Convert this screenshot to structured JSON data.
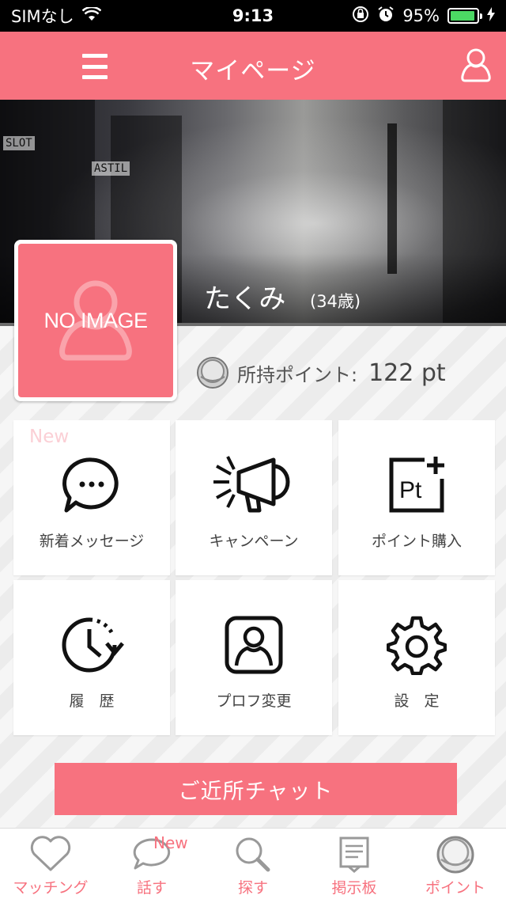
{
  "status_bar": {
    "carrier": "SIMなし",
    "time": "9:13",
    "battery": "95%",
    "battery_level": 0.95
  },
  "nav": {
    "title": "マイページ",
    "menu_icon": "hamburger-icon",
    "user_icon": "user-icon"
  },
  "profile": {
    "name": "たくみ",
    "age": "(34歳)",
    "avatar_text": "NO IMAGE",
    "points_label": "所持ポイント:",
    "points_value": "122 pt"
  },
  "tiles": [
    {
      "label": "新着メッセージ",
      "icon": "chat-bubble-icon",
      "badge": "New"
    },
    {
      "label": "キャンペーン",
      "icon": "megaphone-icon"
    },
    {
      "label": "ポイント購入",
      "icon": "points-purchase-icon"
    },
    {
      "label": "履　歴",
      "icon": "history-clock-icon"
    },
    {
      "label": "プロフ変更",
      "icon": "profile-edit-icon"
    },
    {
      "label": "設　定",
      "icon": "gear-icon"
    }
  ],
  "chat_button": "ご近所チャット",
  "tabs": [
    {
      "label": "マッチング",
      "icon": "heart-icon"
    },
    {
      "label": "話す",
      "icon": "speech-bubble-icon",
      "badge": "New"
    },
    {
      "label": "探す",
      "icon": "search-icon"
    },
    {
      "label": "掲示板",
      "icon": "bulletin-board-icon"
    },
    {
      "label": "ポイント",
      "icon": "coin-icon"
    }
  ],
  "colors": {
    "accent": "#f7727f",
    "battery": "#4cd964"
  }
}
